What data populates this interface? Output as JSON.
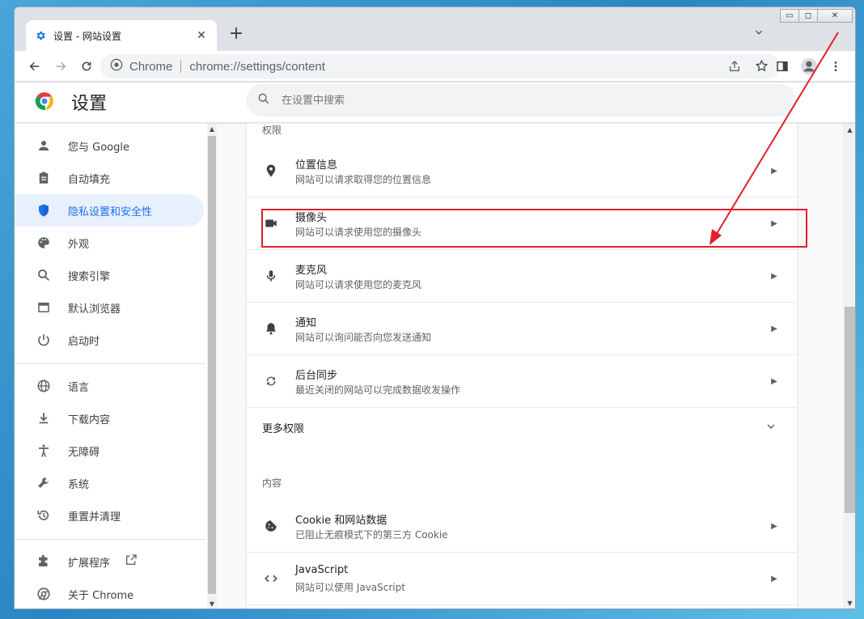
{
  "tab": {
    "title": "设置 - 网站设置",
    "close": "✕"
  },
  "toolbar": {
    "omnibox_site": "Chrome",
    "url": "chrome://settings/content"
  },
  "header": {
    "title": "设置",
    "search_placeholder": "在设置中搜索"
  },
  "sidebar": {
    "items": [
      {
        "label": "您与 Google",
        "icon": "person-icon"
      },
      {
        "label": "自动填充",
        "icon": "clipboard-icon"
      },
      {
        "label": "隐私设置和安全性",
        "icon": "shield-icon",
        "active": true
      },
      {
        "label": "外观",
        "icon": "palette-icon"
      },
      {
        "label": "搜索引擎",
        "icon": "search-icon"
      },
      {
        "label": "默认浏览器",
        "icon": "browser-icon"
      },
      {
        "label": "启动时",
        "icon": "power-icon"
      },
      {
        "label": "语言",
        "icon": "globe-icon"
      },
      {
        "label": "下载内容",
        "icon": "download-icon"
      },
      {
        "label": "无障碍",
        "icon": "accessibility-icon"
      },
      {
        "label": "系统",
        "icon": "wrench-icon"
      },
      {
        "label": "重置并清理",
        "icon": "restore-icon"
      },
      {
        "label": "扩展程序",
        "icon": "puzzle-icon"
      },
      {
        "label": "关于 Chrome",
        "icon": "chrome-icon"
      }
    ]
  },
  "main": {
    "permissions_label": "权限",
    "rows": [
      {
        "title": "位置信息",
        "subtitle": "网站可以请求取得您的位置信息",
        "icon": "location-pin-icon"
      },
      {
        "title": "摄像头",
        "subtitle": "网站可以请求使用您的摄像头",
        "icon": "camera-icon"
      },
      {
        "title": "麦克风",
        "subtitle": "网站可以请求使用您的麦克风",
        "icon": "microphone-icon"
      },
      {
        "title": "通知",
        "subtitle": "网站可以询问能否向您发送通知",
        "icon": "bell-icon"
      },
      {
        "title": "后台同步",
        "subtitle": "最近关闭的网站可以完成数据收发操作",
        "icon": "sync-icon"
      }
    ],
    "more_permissions": "更多权限",
    "content_label": "内容",
    "content_rows": [
      {
        "title": "Cookie 和网站数据",
        "subtitle": "已阻止无痕模式下的第三方 Cookie",
        "icon": "cookie-icon"
      },
      {
        "title": "JavaScript",
        "subtitle": "网站可以使用 JavaScript",
        "icon": "code-icon"
      }
    ]
  },
  "colors": {
    "accent": "#1a73e8",
    "active_bg": "#e8f0fe",
    "annotation": "#e0202a"
  }
}
